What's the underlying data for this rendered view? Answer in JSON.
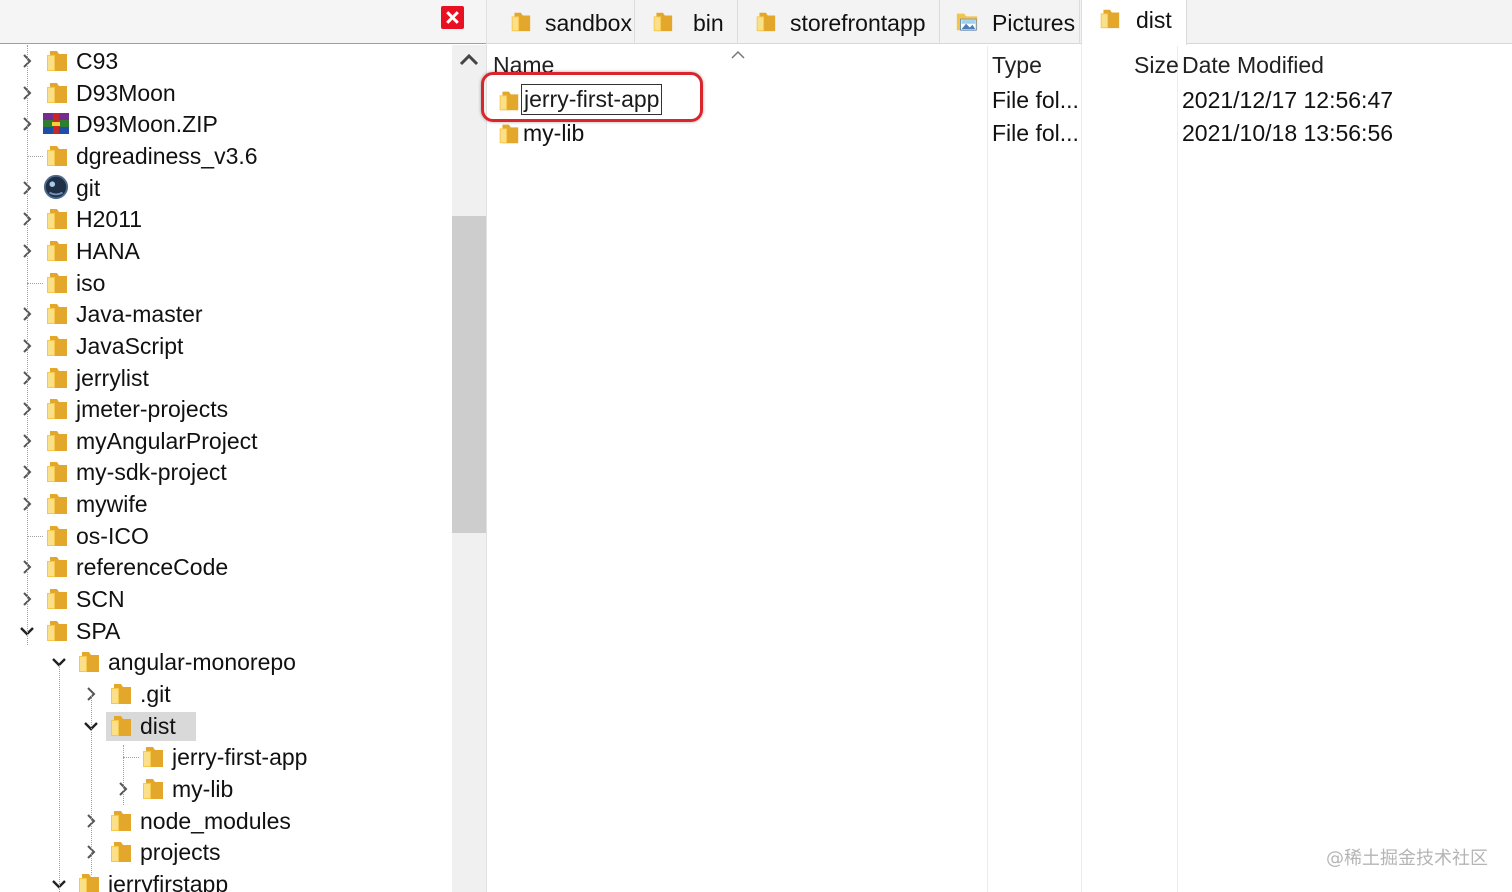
{
  "tabs": [
    {
      "label": "sandbox",
      "icon": "folder-icon"
    },
    {
      "label": "bin",
      "icon": "folder-icon"
    },
    {
      "label": "storefrontapp",
      "icon": "folder-icon"
    },
    {
      "label": "Pictures",
      "icon": "pictures-folder-icon"
    },
    {
      "label": "dist",
      "icon": "folder-icon",
      "active": true
    }
  ],
  "tree": {
    "items": [
      {
        "label": "C93",
        "expander": "collapsed",
        "icon": "folder-icon"
      },
      {
        "label": "D93Moon",
        "expander": "collapsed",
        "icon": "folder-icon"
      },
      {
        "label": "D93Moon.ZIP",
        "expander": "collapsed",
        "icon": "winrar-archive-icon"
      },
      {
        "label": "dgreadiness_v3.6",
        "expander": "none",
        "icon": "folder-icon"
      },
      {
        "label": "git",
        "expander": "collapsed",
        "icon": "git-app-icon"
      },
      {
        "label": "H2011",
        "expander": "collapsed",
        "icon": "folder-icon"
      },
      {
        "label": "HANA",
        "expander": "collapsed",
        "icon": "folder-icon"
      },
      {
        "label": "iso",
        "expander": "none",
        "icon": "folder-icon"
      },
      {
        "label": "Java-master",
        "expander": "collapsed",
        "icon": "folder-icon"
      },
      {
        "label": "JavaScript",
        "expander": "collapsed",
        "icon": "folder-icon"
      },
      {
        "label": "jerrylist",
        "expander": "collapsed",
        "icon": "folder-icon"
      },
      {
        "label": "jmeter-projects",
        "expander": "collapsed",
        "icon": "folder-icon"
      },
      {
        "label": "myAngularProject",
        "expander": "collapsed",
        "icon": "folder-icon"
      },
      {
        "label": "my-sdk-project",
        "expander": "collapsed",
        "icon": "folder-icon"
      },
      {
        "label": "mywife",
        "expander": "collapsed",
        "icon": "folder-icon"
      },
      {
        "label": "os-ICO",
        "expander": "none",
        "icon": "folder-icon"
      },
      {
        "label": "referenceCode",
        "expander": "collapsed",
        "icon": "folder-icon"
      },
      {
        "label": "SCN",
        "expander": "collapsed",
        "icon": "folder-icon"
      },
      {
        "label": "SPA",
        "expander": "expanded",
        "icon": "folder-icon"
      },
      {
        "label": "angular-monorepo",
        "expander": "expanded",
        "icon": "folder-icon",
        "level": 1
      },
      {
        "label": ".git",
        "expander": "collapsed",
        "icon": "folder-icon",
        "level": 2
      },
      {
        "label": "dist",
        "expander": "expanded",
        "icon": "folder-icon",
        "level": 2,
        "selected": true
      },
      {
        "label": "jerry-first-app",
        "expander": "none",
        "icon": "folder-icon",
        "level": 3
      },
      {
        "label": "my-lib",
        "expander": "collapsed",
        "icon": "folder-icon",
        "level": 3
      },
      {
        "label": "node_modules",
        "expander": "collapsed",
        "icon": "folder-icon",
        "level": 2
      },
      {
        "label": "projects",
        "expander": "collapsed",
        "icon": "folder-icon",
        "level": 2
      },
      {
        "label": "jerryfirstapp",
        "expander": "expanded",
        "icon": "folder-icon",
        "level": 1
      }
    ]
  },
  "columns": {
    "name": "Name",
    "type": "Type",
    "size": "Size",
    "date": "Date Modified"
  },
  "files": [
    {
      "name": "jerry-first-app",
      "type": "File fol...",
      "size": "",
      "date": "2021/12/17 12:56:47",
      "renaming": true
    },
    {
      "name": "my-lib",
      "type": "File fol...",
      "size": "",
      "date": "2021/10/18 13:56:56"
    }
  ],
  "watermark": "@稀土掘金技术社区",
  "colors": {
    "folder": "#f8c74a",
    "folder_dark": "#e3a82b",
    "highlight_red": "#d9262c",
    "selection": "#d9d9d9",
    "close_red": "#e81123"
  }
}
